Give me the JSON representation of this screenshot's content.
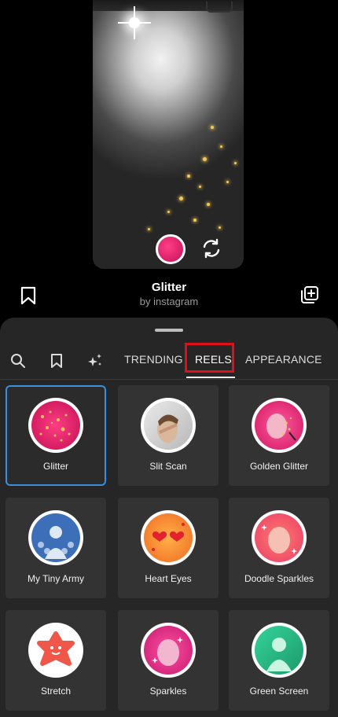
{
  "effect": {
    "title": "Glitter",
    "author": "by instagram"
  },
  "icons": {
    "bookmark": "bookmark-icon",
    "add_to_collection": "add-square-icon",
    "search": "search-icon",
    "saved": "bookmark-icon",
    "sparkles": "sparkles-icon",
    "flip_camera": "flip-camera-icon"
  },
  "tabs": [
    {
      "label": "TRENDING",
      "active": false
    },
    {
      "label": "REELS",
      "active": true
    },
    {
      "label": "APPEARANCE",
      "active": false
    }
  ],
  "effects": [
    {
      "label": "Glitter",
      "selected": true
    },
    {
      "label": "Slit Scan",
      "selected": false
    },
    {
      "label": "Golden Glitter",
      "selected": false
    },
    {
      "label": "My Tiny Army",
      "selected": false
    },
    {
      "label": "Heart Eyes",
      "selected": false
    },
    {
      "label": "Doodle Sparkles",
      "selected": false
    },
    {
      "label": "Stretch",
      "selected": false
    },
    {
      "label": "Sparkles",
      "selected": false
    },
    {
      "label": "Green Screen",
      "selected": false
    }
  ],
  "colors": {
    "selected_outline": "#3a8fdc",
    "highlight_box": "#e10f1a",
    "panel_bg": "#262626"
  }
}
